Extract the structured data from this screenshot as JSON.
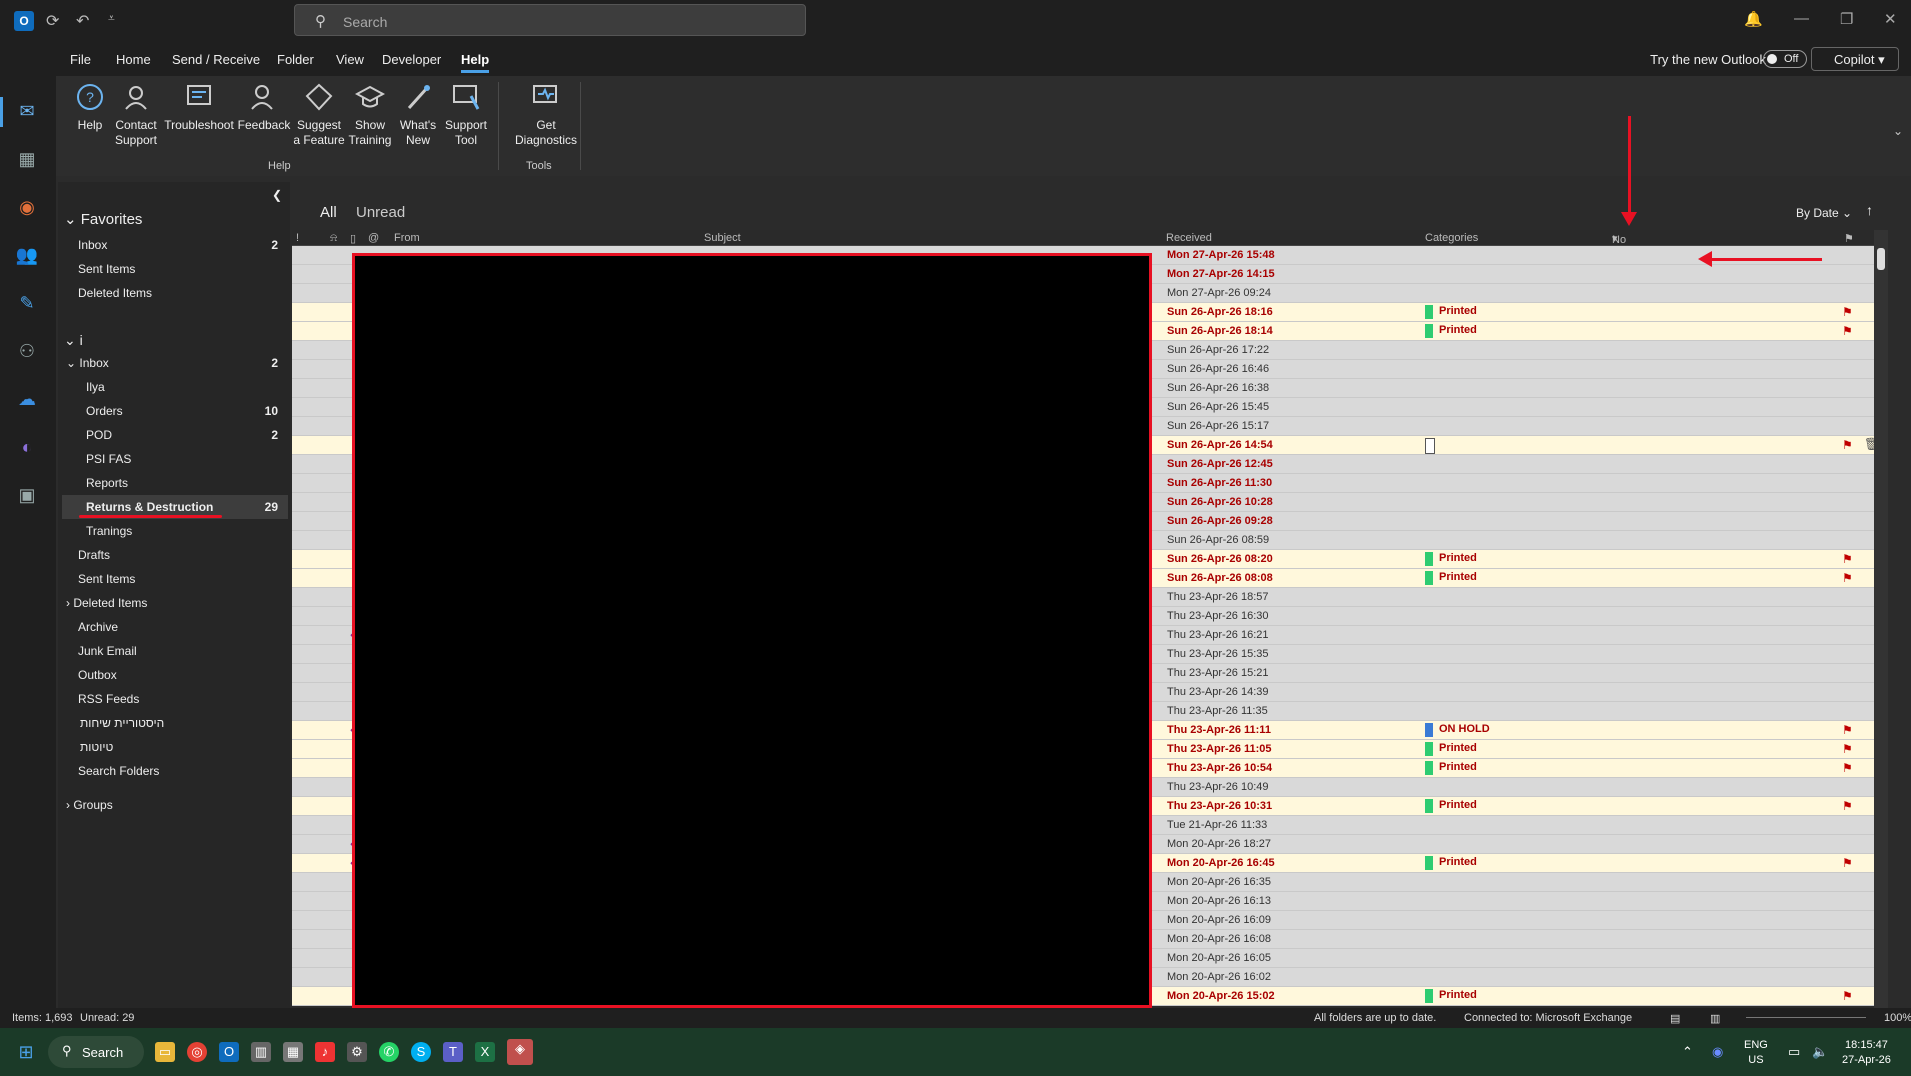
{
  "app": {
    "title_icon": "outlook-icon",
    "search_placeholder": "Search"
  },
  "menu": {
    "items": [
      "File",
      "Home",
      "Send / Receive",
      "Folder",
      "View",
      "Developer",
      "Help"
    ],
    "active": "Help",
    "try_new": "Try the new Outlook",
    "toggle": "Off",
    "copilot": "Copilot"
  },
  "ribbon": {
    "buttons": [
      {
        "label": "Help",
        "icon": "help-icon"
      },
      {
        "label": "Contact Support",
        "icon": "contact-support-icon"
      },
      {
        "label": "Troubleshoot",
        "icon": "troubleshoot-icon"
      },
      {
        "label": "Feedback",
        "icon": "feedback-icon"
      },
      {
        "label": "Suggest a Feature",
        "icon": "suggest-feature-icon"
      },
      {
        "label": "Show Training",
        "icon": "training-icon"
      },
      {
        "label": "What's New",
        "icon": "whats-new-icon"
      },
      {
        "label": "Support Tool",
        "icon": "support-tool-icon"
      },
      {
        "label": "Get Diagnostics",
        "icon": "diagnostics-icon"
      }
    ],
    "groups": [
      "Help",
      "Tools"
    ]
  },
  "folders": {
    "favorites": "Favorites",
    "fav_items": [
      {
        "name": "Inbox",
        "count": "2"
      },
      {
        "name": "Sent Items",
        "count": ""
      },
      {
        "name": "Deleted Items",
        "count": ""
      }
    ],
    "account": "i",
    "inbox": {
      "name": "Inbox",
      "count": "2"
    },
    "inbox_sub": [
      {
        "name": "Ilya",
        "count": ""
      },
      {
        "name": "Orders",
        "count": "10"
      },
      {
        "name": "POD",
        "count": "2"
      },
      {
        "name": "PSI FAS",
        "count": ""
      },
      {
        "name": "Reports",
        "count": ""
      },
      {
        "name": "Returns & Destruction",
        "count": "29"
      },
      {
        "name": "Tranings",
        "count": ""
      }
    ],
    "others": [
      "Drafts",
      "Sent Items",
      "Deleted Items",
      "Archive",
      "Junk Email",
      "Outbox",
      "RSS Feeds",
      "היסטוריית שיחות",
      "טיוטות",
      "Search Folders"
    ],
    "groups": "Groups"
  },
  "list": {
    "views": [
      "All",
      "Unread"
    ],
    "sort": "By Date",
    "columns": {
      "from": "From",
      "subject": "Subject",
      "received": "Received",
      "categories": "Categories",
      "nort": "No RT"
    },
    "rows": [
      {
        "r": "Mon 27-Apr-26 15:48",
        "u": true,
        "h": false,
        "c": "",
        "f": false
      },
      {
        "r": "Mon 27-Apr-26 14:15",
        "u": true,
        "h": false,
        "c": "",
        "f": false
      },
      {
        "r": "Mon 27-Apr-26 09:24",
        "u": false,
        "h": false,
        "c": "",
        "f": false
      },
      {
        "r": "Sun 26-Apr-26 18:16",
        "u": true,
        "h": true,
        "c": "Printed",
        "f": true
      },
      {
        "r": "Sun 26-Apr-26 18:14",
        "u": true,
        "h": true,
        "c": "Printed",
        "f": true
      },
      {
        "r": "Sun 26-Apr-26 17:22",
        "u": false,
        "h": false,
        "c": "",
        "f": false
      },
      {
        "r": "Sun 26-Apr-26 16:46",
        "u": false,
        "h": false,
        "c": "",
        "f": false
      },
      {
        "r": "Sun 26-Apr-26 16:38",
        "u": false,
        "h": false,
        "c": "",
        "f": false
      },
      {
        "r": "Sun 26-Apr-26 15:45",
        "u": false,
        "h": false,
        "c": "",
        "f": false
      },
      {
        "r": "Sun 26-Apr-26 15:17",
        "u": false,
        "h": false,
        "c": "",
        "f": false
      },
      {
        "r": "Sun 26-Apr-26 14:54",
        "u": true,
        "h": true,
        "c": "empty",
        "f": true,
        "d": true
      },
      {
        "r": "Sun 26-Apr-26 12:45",
        "u": true,
        "h": false,
        "c": "",
        "f": false
      },
      {
        "r": "Sun 26-Apr-26 11:30",
        "u": true,
        "h": false,
        "c": "",
        "f": false
      },
      {
        "r": "Sun 26-Apr-26 10:28",
        "u": true,
        "h": false,
        "c": "",
        "f": false
      },
      {
        "r": "Sun 26-Apr-26 09:28",
        "u": true,
        "h": false,
        "c": "",
        "f": false
      },
      {
        "r": "Sun 26-Apr-26 08:59",
        "u": false,
        "h": false,
        "c": "",
        "f": false
      },
      {
        "r": "Sun 26-Apr-26 08:20",
        "u": true,
        "h": true,
        "c": "Printed",
        "f": true
      },
      {
        "r": "Sun 26-Apr-26 08:08",
        "u": true,
        "h": true,
        "c": "Printed",
        "f": true
      },
      {
        "r": "Thu 23-Apr-26 18:57",
        "u": false,
        "h": false,
        "c": "",
        "f": false
      },
      {
        "r": "Thu 23-Apr-26 16:30",
        "u": false,
        "h": false,
        "c": "",
        "f": false
      },
      {
        "r": "Thu 23-Apr-26 16:21",
        "u": false,
        "h": false,
        "c": "",
        "f": false,
        "rp": true
      },
      {
        "r": "Thu 23-Apr-26 15:35",
        "u": false,
        "h": false,
        "c": "",
        "f": false
      },
      {
        "r": "Thu 23-Apr-26 15:21",
        "u": false,
        "h": false,
        "c": "",
        "f": false
      },
      {
        "r": "Thu 23-Apr-26 14:39",
        "u": false,
        "h": false,
        "c": "",
        "f": false
      },
      {
        "r": "Thu 23-Apr-26 11:35",
        "u": false,
        "h": false,
        "c": "",
        "f": false
      },
      {
        "r": "Thu 23-Apr-26 11:11",
        "u": true,
        "h": true,
        "c": "ON HOLD",
        "f": true,
        "rp": true
      },
      {
        "r": "Thu 23-Apr-26 11:05",
        "u": true,
        "h": true,
        "c": "Printed",
        "f": true
      },
      {
        "r": "Thu 23-Apr-26 10:54",
        "u": true,
        "h": true,
        "c": "Printed",
        "f": true
      },
      {
        "r": "Thu 23-Apr-26 10:49",
        "u": false,
        "h": false,
        "c": "",
        "f": false
      },
      {
        "r": "Thu 23-Apr-26 10:31",
        "u": true,
        "h": true,
        "c": "Printed",
        "f": true
      },
      {
        "r": "Tue 21-Apr-26 11:33",
        "u": false,
        "h": false,
        "c": "",
        "f": false
      },
      {
        "r": "Mon 20-Apr-26 18:27",
        "u": false,
        "h": false,
        "c": "",
        "f": false,
        "rp": true
      },
      {
        "r": "Mon 20-Apr-26 16:45",
        "u": true,
        "h": true,
        "c": "Printed",
        "f": true,
        "rp": true
      },
      {
        "r": "Mon 20-Apr-26 16:35",
        "u": false,
        "h": false,
        "c": "",
        "f": false
      },
      {
        "r": "Mon 20-Apr-26 16:13",
        "u": false,
        "h": false,
        "c": "",
        "f": false
      },
      {
        "r": "Mon 20-Apr-26 16:09",
        "u": false,
        "h": false,
        "c": "",
        "f": false
      },
      {
        "r": "Mon 20-Apr-26 16:08",
        "u": false,
        "h": false,
        "c": "",
        "f": false
      },
      {
        "r": "Mon 20-Apr-26 16:05",
        "u": false,
        "h": false,
        "c": "",
        "f": false
      },
      {
        "r": "Mon 20-Apr-26 16:02",
        "u": false,
        "h": false,
        "c": "",
        "f": false
      },
      {
        "r": "Mon 20-Apr-26 15:02",
        "u": true,
        "h": true,
        "c": "Printed",
        "f": true
      }
    ]
  },
  "colors": {
    "printed": "#2ecc71",
    "on_hold": "#3a7bd5",
    "unread": "#a80000",
    "highlight": "#fff8dc"
  },
  "status": {
    "items": "Items: 1,693",
    "unread": "Unread: 29",
    "sync": "All folders are up to date.",
    "connected": "Connected to: Microsoft Exchange",
    "zoom": "100%"
  },
  "taskbar": {
    "search": "Search",
    "lang": "ENG",
    "region": "US",
    "time": "18:15:47",
    "date": "27-Apr-26"
  }
}
